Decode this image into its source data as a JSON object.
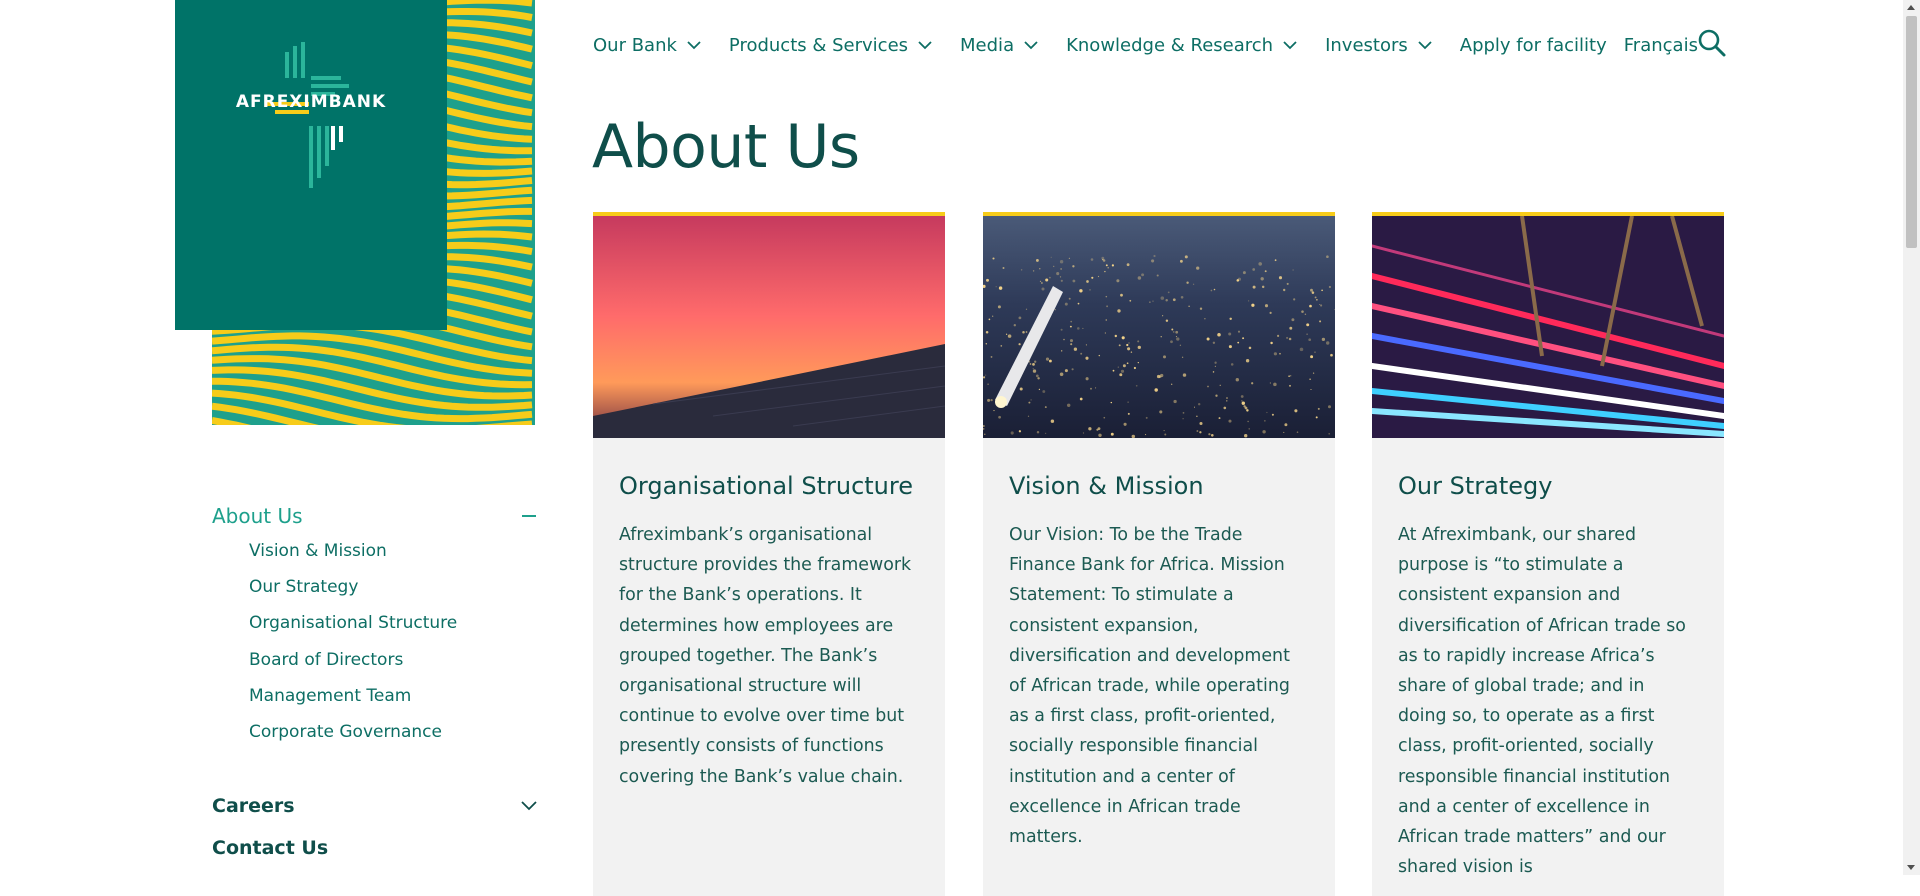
{
  "brand": {
    "name": "AFREXIMBANK",
    "primary_color": "#007368",
    "accent_color": "#f7cc1a",
    "pattern_green": "#1ea08c"
  },
  "nav": {
    "items": [
      {
        "label": "Our Bank",
        "has_dropdown": true
      },
      {
        "label": "Products & Services",
        "has_dropdown": true
      },
      {
        "label": "Media",
        "has_dropdown": true
      },
      {
        "label": "Knowledge & Research",
        "has_dropdown": true
      },
      {
        "label": "Investors",
        "has_dropdown": true
      },
      {
        "label": "Apply for facility",
        "has_dropdown": false
      },
      {
        "label": "Français",
        "has_dropdown": false
      }
    ],
    "search_icon": "search-icon"
  },
  "page": {
    "title": "About Us"
  },
  "sidebar": {
    "active_section": "About Us",
    "items": [
      {
        "label": "Vision & Mission"
      },
      {
        "label": "Our Strategy"
      },
      {
        "label": "Organisational Structure"
      },
      {
        "label": "Board of Directors"
      },
      {
        "label": "Management Team"
      },
      {
        "label": "Corporate Governance"
      }
    ],
    "careers": "Careers",
    "contact": "Contact Us"
  },
  "cards": [
    {
      "title": "Organisational Structure",
      "text": "Afreximbank’s organisational structure provides the framework for the Bank’s operations. It determines how employees are grouped together. The Bank’s organisational structure will continue to evolve over time but presently consists of functions covering the Bank’s value chain.",
      "image": "sunset-over-solar-panels"
    },
    {
      "title": "Vision & Mission",
      "text": "Our Vision: To be the Trade Finance Bank for Africa. Mission Statement: To stimulate a consistent expansion, diversification and development of African trade, while operating as a first class, profit-oriented, socially responsible financial institution and a center of excellence in African trade matters.",
      "image": "night-city-from-airplane"
    },
    {
      "title": "Our Strategy",
      "text": "At Afreximbank, our shared purpose is “to stimulate a consistent expansion and diversification of African trade so as to rapidly increase Africa’s share of global trade; and in doing so, to operate as a first class, profit-oriented, socially responsible financial institution and a center of excellence in African trade matters” and our shared vision is",
      "image": "light-trails-bridge"
    }
  ]
}
